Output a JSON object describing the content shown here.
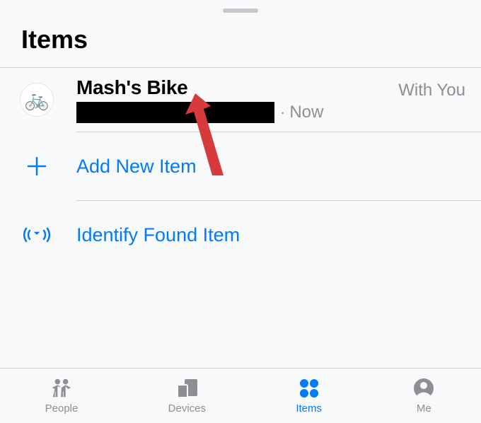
{
  "header": {
    "title": "Items"
  },
  "item": {
    "name": "Mash's Bike",
    "time": "Now",
    "status": "With You",
    "icon": "bicycle"
  },
  "actions": {
    "add_label": "Add New Item",
    "identify_label": "Identify Found Item"
  },
  "tabs": {
    "people": "People",
    "devices": "Devices",
    "items": "Items",
    "me": "Me"
  },
  "colors": {
    "accent": "#007aff",
    "inactive": "#8e8e93"
  }
}
